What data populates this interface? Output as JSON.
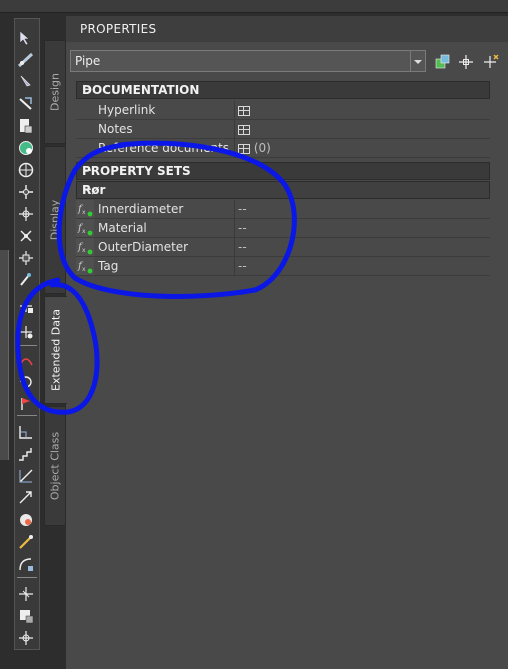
{
  "panel": {
    "title": "PROPERTIES"
  },
  "selector": {
    "value": "Pipe"
  },
  "tabs": [
    {
      "label": "Design"
    },
    {
      "label": "Display"
    },
    {
      "label": "Extended Data"
    },
    {
      "label": "Object Class"
    }
  ],
  "documentation": {
    "header": "DOCUMENTATION",
    "rows": [
      {
        "label": "Hyperlink",
        "value": ""
      },
      {
        "label": "Notes",
        "value": ""
      },
      {
        "label": "Reference documents",
        "value": "(0)"
      }
    ]
  },
  "property_sets": {
    "header": "PROPERTY SETS",
    "group": "Rør",
    "rows": [
      {
        "label": "Innerdiameter",
        "value": "--"
      },
      {
        "label": "Material",
        "value": "--"
      },
      {
        "label": "OuterDiameter",
        "value": "--"
      },
      {
        "label": "Tag",
        "value": "--"
      }
    ]
  },
  "collapse_symbol": "−",
  "annotation_color": "#0a17e6"
}
